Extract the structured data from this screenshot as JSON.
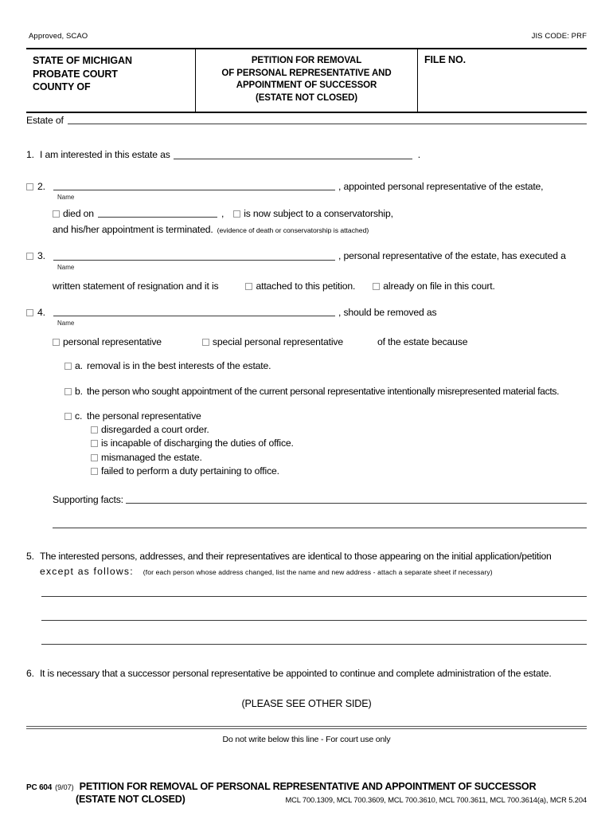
{
  "meta": {
    "approved": "Approved, SCAO",
    "jis_code": "JIS CODE: PRF"
  },
  "header": {
    "court_lines": [
      "STATE OF MICHIGAN",
      "PROBATE COURT",
      "COUNTY OF"
    ],
    "title_lines": [
      "PETITION FOR REMOVAL",
      "OF PERSONAL REPRESENTATIVE AND",
      "APPOINTMENT OF SUCCESSOR",
      "(ESTATE NOT CLOSED)"
    ],
    "file_no_label": "FILE NO."
  },
  "estate": {
    "label": "Estate of"
  },
  "items": {
    "i1": {
      "number": "1.",
      "text": "I am interested in this estate as",
      "period": "."
    },
    "i2": {
      "number": "2.",
      "name_caption": "Name",
      "tail": ", appointed personal representative of the estate,",
      "died_on": "died on",
      "comma": ",",
      "conservatorship": "is now subject to a conservatorship,",
      "terminated": "and his/her appointment is terminated.",
      "evidence_note": "(evidence of death or conservatorship is attached)"
    },
    "i3": {
      "number": "3.",
      "name_caption": "Name",
      "tail": ", personal representative of the estate, has executed a",
      "line2_lead": "written statement of resignation and it is",
      "opt_attached": "attached to this petition.",
      "opt_onfile": "already on file in this court."
    },
    "i4": {
      "number": "4.",
      "name_caption": "Name",
      "tail": ", should be removed as",
      "opt_pr": "personal representative",
      "opt_spr": "special personal representative",
      "because": "of the estate because",
      "a": {
        "letter": "a.",
        "text": "removal is in the best interests of the estate."
      },
      "b": {
        "letter": "b.",
        "text": "the person who sought appointment of the current personal representative intentionally misrepresented material facts."
      },
      "c": {
        "letter": "c.",
        "text": "the personal representative",
        "options": [
          "disregarded a court order.",
          "is incapable of discharging the duties of office.",
          "mismanaged the estate.",
          "failed to perform a duty pertaining to office."
        ]
      },
      "supporting_facts_label": "Supporting facts:"
    },
    "i5": {
      "number": "5.",
      "line1": "The interested persons, addresses, and their representatives are identical to those appearing on the initial application/petition",
      "line2_lead": "except as follows:",
      "note": "(for each person whose address changed, list the name and new address - attach a separate sheet if necessary)"
    },
    "i6": {
      "number": "6.",
      "text": "It is necessary that a successor personal representative be appointed to continue and complete administration of the estate."
    }
  },
  "notices": {
    "see_other_side": "(PLEASE SEE OTHER SIDE)",
    "court_use_only": "Do not write below this line - For court use only"
  },
  "footer": {
    "form_code": "PC 604",
    "revision": "(9/07)",
    "title": "PETITION FOR REMOVAL OF PERSONAL REPRESENTATIVE AND APPOINTMENT OF SUCCESSOR",
    "subtitle": "(ESTATE NOT CLOSED)",
    "citations": "MCL 700.1309, MCL 700.3609, MCL 700.3610, MCL 700.3611, MCL 700.3614(a), MCR 5.204"
  },
  "colors": {
    "ink": "#000000",
    "rule": "#3a3a3a",
    "checkbox_border": "#9a9a9a"
  }
}
